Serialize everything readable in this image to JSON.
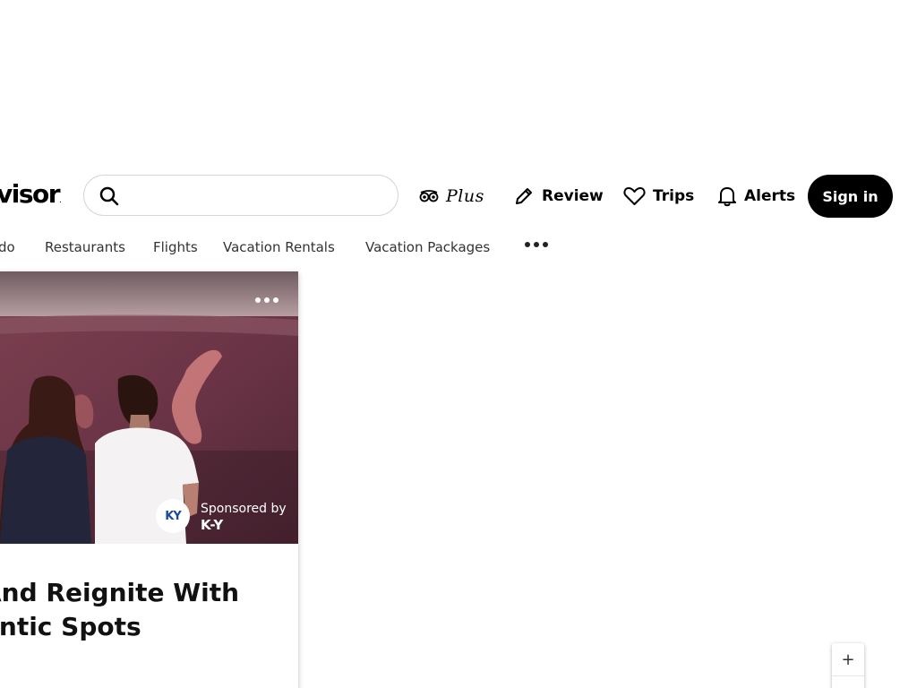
{
  "header": {
    "logo_text": "visor",
    "logo_mark": ".",
    "search": {
      "placeholder": "",
      "value": ""
    },
    "plus_label": "Plus",
    "review_label": "Review",
    "trips_label": "Trips",
    "alerts_label": "Alerts",
    "signin_label": "Sign in"
  },
  "categories": {
    "items": [
      "do",
      "Restaurants",
      "Flights",
      "Vacation Rentals",
      "Vacation Packages"
    ]
  },
  "card": {
    "sponsor_by": "Sponsored by",
    "sponsor_name": "K-Y",
    "sponsor_logo_text": "KY",
    "title_line1": "And Reignite With",
    "title_line2": "antic Spots"
  },
  "map": {
    "zoom_in_label": "+"
  },
  "colors": {
    "primary": "#000000",
    "sponsor_blue": "#1a4a9e"
  }
}
